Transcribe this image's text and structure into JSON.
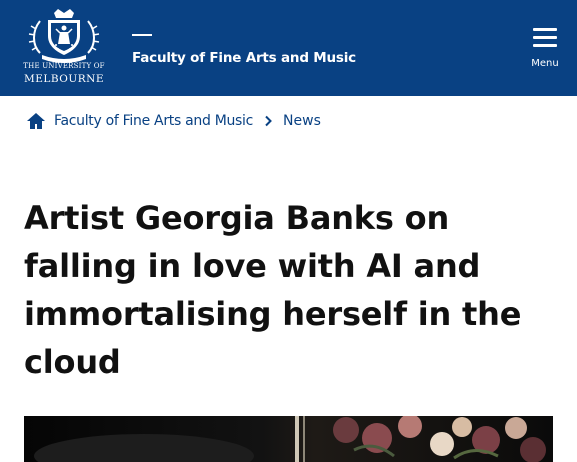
{
  "header": {
    "logo": {
      "line1": "THE UNIVERSITY OF",
      "line2": "MELBOURNE"
    },
    "faculty_title": "Faculty of Fine Arts and Music",
    "menu_label": "Menu"
  },
  "breadcrumb": {
    "items": [
      {
        "label": "Faculty of Fine Arts and Music"
      },
      {
        "label": "News"
      }
    ]
  },
  "article": {
    "headline": "Artist Georgia Banks on falling in love with AI and immortalising herself in the cloud"
  },
  "colors": {
    "brand": "#094183",
    "text": "#111111",
    "background": "#ffffff"
  },
  "icons": [
    "university-crest-icon",
    "menu-icon",
    "home-icon",
    "chevron-right-icon"
  ]
}
